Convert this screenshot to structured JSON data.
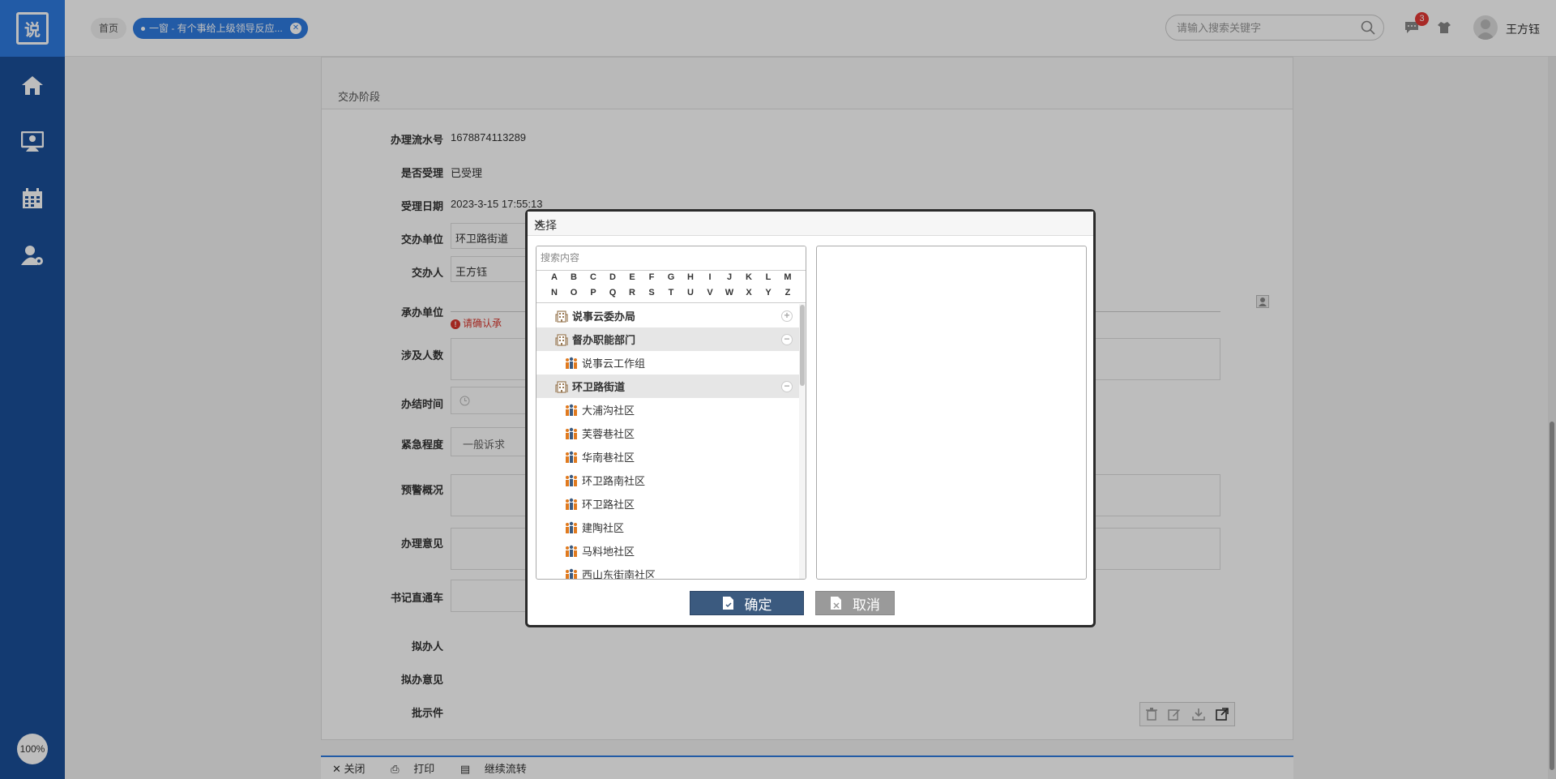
{
  "sidebar": {
    "logo": "说",
    "zoom": "100%"
  },
  "topbar": {
    "home_tab": "首页",
    "active_tab": "一窗 - 有个事给上级领导反应...",
    "search_placeholder": "请输入搜索关键字",
    "message_count": "3",
    "username": "王方钰"
  },
  "form": {
    "section_title": "交办阶段",
    "rows": [
      {
        "label": "办理流水号",
        "value": "1678874113289"
      },
      {
        "label": "是否受理",
        "value": "已受理"
      },
      {
        "label": "受理日期",
        "value": "2023-3-15 17:55:13"
      },
      {
        "label": "交办单位",
        "value": "环卫路街道"
      },
      {
        "label": "交办人",
        "value": "王方钰"
      },
      {
        "label": "承办单位",
        "value": ""
      },
      {
        "label": "涉及人数",
        "value": ""
      },
      {
        "label": "办结时间",
        "value": ""
      },
      {
        "label": "紧急程度",
        "value": "一般诉求"
      },
      {
        "label": "预警概况",
        "value": ""
      },
      {
        "label": "办理意见",
        "value": ""
      },
      {
        "label": "书记直通车",
        "value": ""
      },
      {
        "label": "拟办人",
        "value": ""
      },
      {
        "label": "拟办意见",
        "value": ""
      },
      {
        "label": "批示件",
        "value": ""
      }
    ],
    "warning": "请确认承"
  },
  "bottom_bar": {
    "close": "关闭",
    "print": "打印",
    "continue": "继续流转"
  },
  "dialog": {
    "title": "选择",
    "search_placeholder": "搜索内容",
    "alphabet_row1": [
      "A",
      "B",
      "C",
      "D",
      "E",
      "F",
      "G",
      "H",
      "I",
      "J",
      "K",
      "L",
      "M"
    ],
    "alphabet_row2": [
      "N",
      "O",
      "P",
      "Q",
      "R",
      "S",
      "T",
      "U",
      "V",
      "W",
      "X",
      "Y",
      "Z"
    ],
    "tree": [
      {
        "label": "说事云委办局",
        "type": "group",
        "state": "collapsed"
      },
      {
        "label": "督办职能部门",
        "type": "group",
        "state": "expanded"
      },
      {
        "label": "说事云工作组",
        "type": "item"
      },
      {
        "label": "环卫路街道",
        "type": "group",
        "state": "expanded"
      },
      {
        "label": "大浦沟社区",
        "type": "item"
      },
      {
        "label": "芙蓉巷社区",
        "type": "item"
      },
      {
        "label": "华南巷社区",
        "type": "item"
      },
      {
        "label": "环卫路南社区",
        "type": "item"
      },
      {
        "label": "环卫路社区",
        "type": "item"
      },
      {
        "label": "建陶社区",
        "type": "item"
      },
      {
        "label": "马料地社区",
        "type": "item"
      },
      {
        "label": "西山东街南社区",
        "type": "item"
      }
    ],
    "ok_label": "确定",
    "cancel_label": "取消"
  }
}
